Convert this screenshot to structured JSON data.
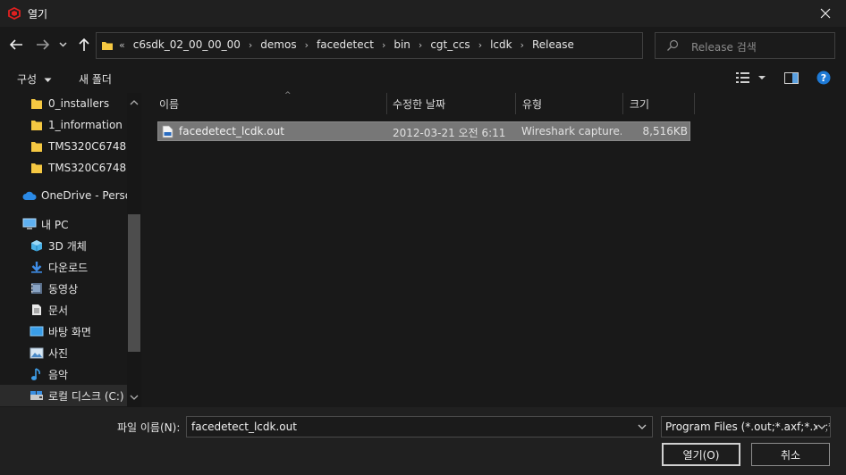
{
  "window": {
    "title": "열기"
  },
  "nav": {
    "back_icon": "back-arrow-icon",
    "forward_icon": "forward-arrow-icon",
    "recent_icon": "chevron-down-icon",
    "up_icon": "up-arrow-icon"
  },
  "address": {
    "overflow": "«",
    "crumbs": [
      "c6sdk_02_00_00_00",
      "demos",
      "facedetect",
      "bin",
      "cgt_ccs",
      "lcdk",
      "Release"
    ],
    "separator": "›"
  },
  "search": {
    "placeholder": "Release 검색"
  },
  "toolbar": {
    "organize_label": "구성",
    "new_folder_label": "새 폴더"
  },
  "sidebar": {
    "items": [
      {
        "label": "0_installers",
        "icon": "folder-icon",
        "indent": true
      },
      {
        "label": "1_information",
        "icon": "folder-icon",
        "indent": true
      },
      {
        "label": "TMS320C6748",
        "icon": "folder-icon",
        "indent": true
      },
      {
        "label": "TMS320C6748",
        "icon": "folder-icon",
        "indent": true
      },
      {
        "label": "OneDrive - Persor",
        "icon": "cloud-icon",
        "indent": false
      },
      {
        "label": "내 PC",
        "icon": "computer-icon",
        "indent": false
      },
      {
        "label": "3D 개체",
        "icon": "cube-icon",
        "indent": true
      },
      {
        "label": "다운로드",
        "icon": "download-icon",
        "indent": true
      },
      {
        "label": "동영상",
        "icon": "video-icon",
        "indent": true
      },
      {
        "label": "문서",
        "icon": "document-icon",
        "indent": true
      },
      {
        "label": "바탕 화면",
        "icon": "desktop-icon",
        "indent": true
      },
      {
        "label": "사진",
        "icon": "picture-icon",
        "indent": true
      },
      {
        "label": "음악",
        "icon": "music-icon",
        "indent": true
      },
      {
        "label": "로컬 디스크 (C:)",
        "icon": "drive-icon",
        "indent": true
      }
    ]
  },
  "columns": {
    "name": "이름",
    "date": "수정한 날짜",
    "type": "유형",
    "size": "크기"
  },
  "files": [
    {
      "name": "facedetect_lcdk.out",
      "date": "2012-03-21 오전 6:11",
      "type": "Wireshark capture...",
      "size": "8,516KB"
    }
  ],
  "footer": {
    "filename_label": "파일 이름(N):",
    "filename_value": "facedetect_lcdk.out",
    "filter_value": "Program Files (*.out;*.axf;*.x*;*",
    "open_label": "열기(O)",
    "cancel_label": "취소"
  },
  "colors": {
    "background": "#191919",
    "selection": "#777777",
    "folder": "#f5c842",
    "accent_help": "#1e7ad6"
  }
}
